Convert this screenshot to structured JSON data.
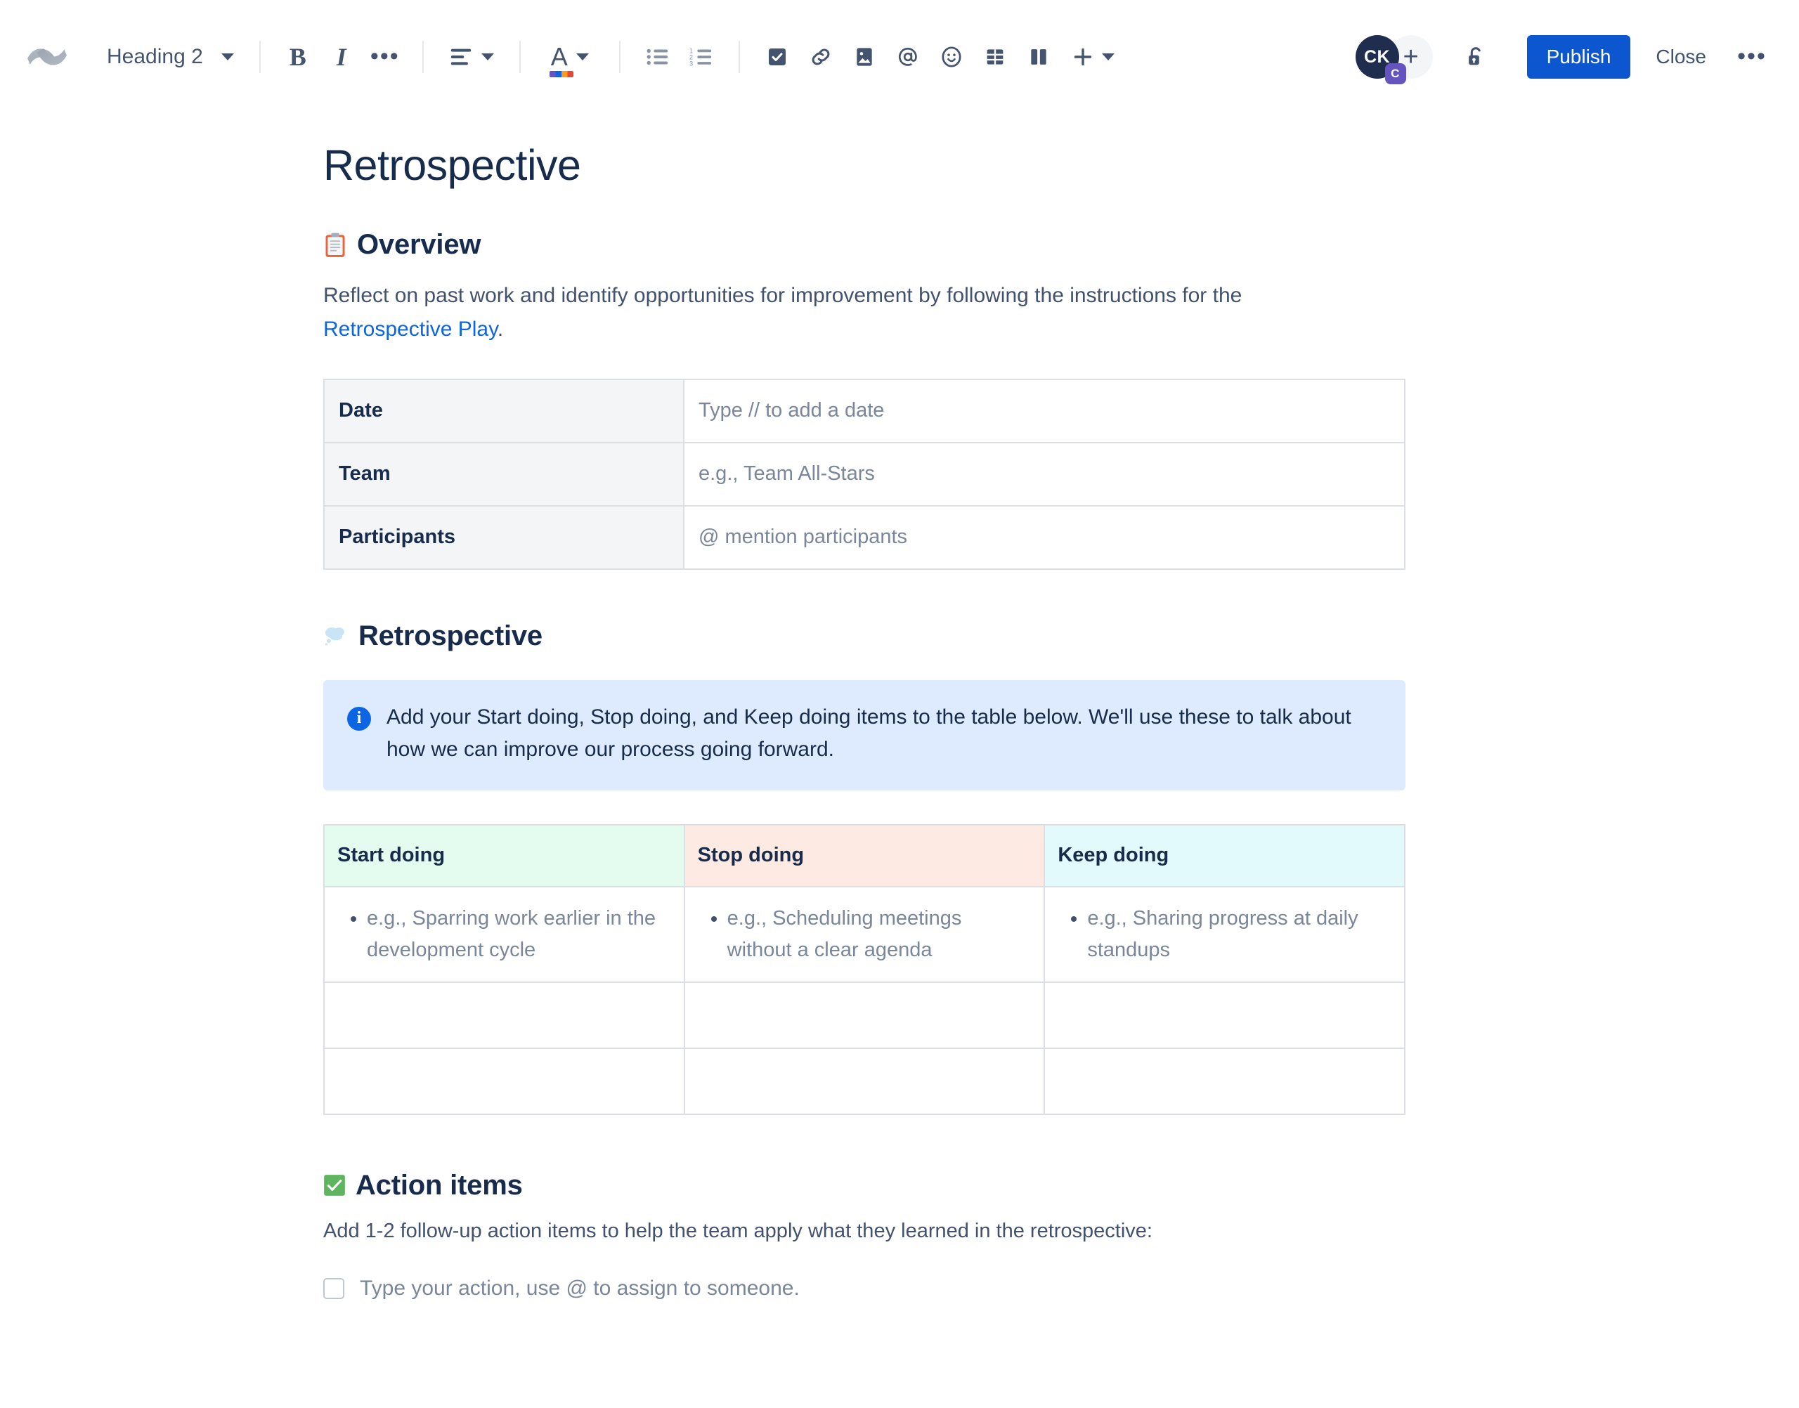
{
  "toolbar": {
    "logo_name": "confluence-logo",
    "style_select": {
      "label": "Heading 2",
      "icon": "chevron-down-icon"
    },
    "format": [
      {
        "name": "bold-button",
        "label": "B",
        "icon": "bold-icon"
      },
      {
        "name": "italic-button",
        "label": "I",
        "icon": "italic-icon"
      },
      {
        "name": "more-formatting-button",
        "label": "•••",
        "icon": "ellipsis-icon"
      }
    ],
    "align_label": "text-align-left",
    "color_label": "A",
    "lists": [
      {
        "name": "bullet-list-button",
        "icon": "bullet-list-icon"
      },
      {
        "name": "numbered-list-button",
        "icon": "numbered-list-icon"
      }
    ],
    "inserts": [
      {
        "name": "task-list-button",
        "icon": "checkbox-icon"
      },
      {
        "name": "link-button",
        "icon": "link-icon"
      },
      {
        "name": "image-button",
        "icon": "image-icon"
      },
      {
        "name": "mention-button",
        "icon": "at-mention-icon"
      },
      {
        "name": "emoji-button",
        "icon": "emoji-icon"
      },
      {
        "name": "table-button",
        "icon": "table-icon"
      },
      {
        "name": "layout-button",
        "icon": "layout-columns-icon"
      },
      {
        "name": "insert-more-button",
        "icon": "plus-icon"
      }
    ],
    "avatar": {
      "initials": "CK",
      "badge": "C",
      "add_label": "+"
    },
    "restrictions_icon": "unlock-icon",
    "publish_label": "Publish",
    "close_label": "Close",
    "more_label": "•••"
  },
  "document": {
    "title": "Retrospective",
    "sections": {
      "overview": {
        "emoji": "clipboard",
        "heading": "Overview",
        "paragraph_before": "Reflect on past work and identify opportunities for improvement by following the instructions for the ",
        "link_text": "Retrospective Play",
        "paragraph_after": ".",
        "table": {
          "rows": [
            {
              "label": "Date",
              "value": "Type // to add a date"
            },
            {
              "label": "Team",
              "value": "e.g., Team All-Stars"
            },
            {
              "label": "Participants",
              "value": "@ mention participants"
            }
          ]
        }
      },
      "retrospective": {
        "emoji": "thought-balloon",
        "heading": "Retrospective",
        "info_panel": {
          "icon": "info-icon",
          "text": "Add your Start doing, Stop doing, and Keep doing items to the table below. We'll use these to talk about how we can improve our process going forward."
        },
        "table": {
          "headers": [
            "Start doing",
            "Stop doing",
            "Keep doing"
          ],
          "header_colors": [
            "#e3fcef",
            "#fdeae3",
            "#e3fafc"
          ],
          "rows": [
            [
              "e.g., Sparring work earlier in the development cycle",
              "e.g., Scheduling meetings without a clear agenda",
              "e.g., Sharing progress at daily standups"
            ],
            [
              "",
              "",
              ""
            ],
            [
              "",
              "",
              ""
            ]
          ]
        }
      },
      "action_items": {
        "emoji": "white-check-mark",
        "heading": "Action items",
        "description": "Add 1-2 follow-up action items to help the team apply what they learned in the retrospective:",
        "task": {
          "checked": false,
          "label": "Type your action, use @ to assign to someone."
        }
      }
    }
  },
  "colors": {
    "brand_blue": "#0c56d0",
    "link_blue": "#0c66e4",
    "text_primary": "#172b4d",
    "text_subtle": "#7a869a",
    "panel_info_bg": "#deebff",
    "table_header_bg": "#f4f5f7",
    "border": "#dcdfe4"
  }
}
